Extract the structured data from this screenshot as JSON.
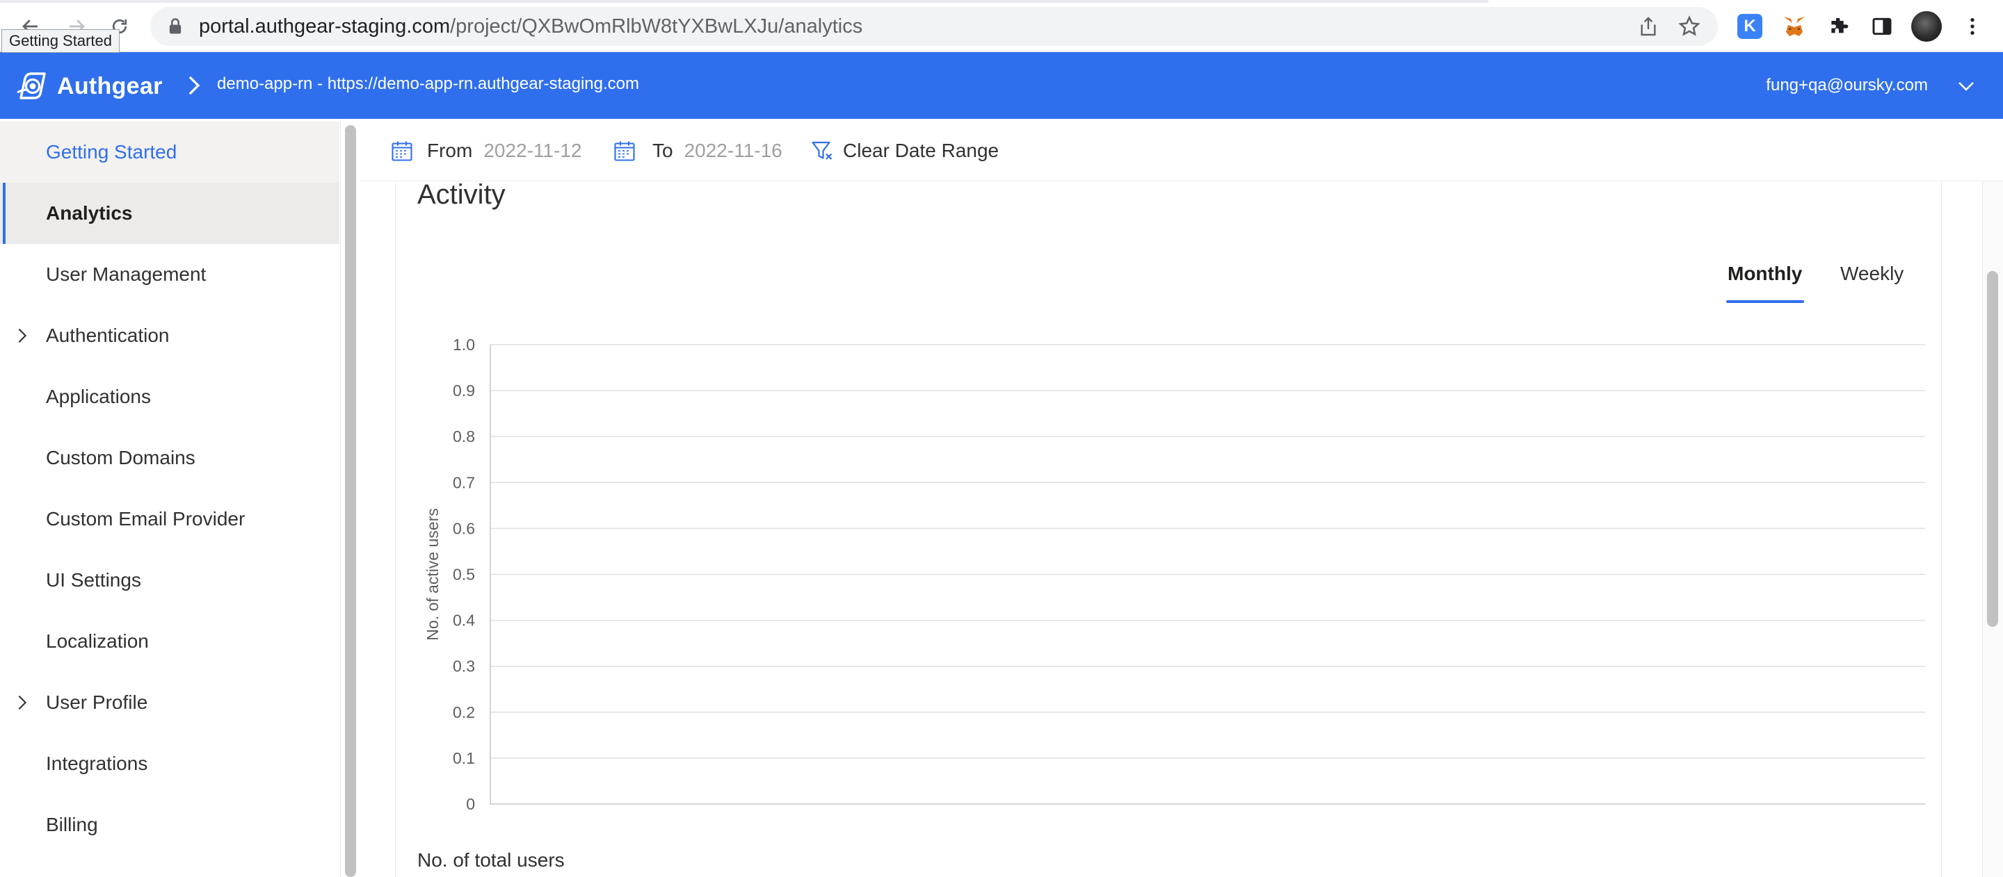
{
  "browser": {
    "tooltip": "Getting Started",
    "url_host": "portal.authgear-staging.com",
    "url_path": "/project/QXBwOmRlbW8tYXBwLXJu/analytics",
    "extensions": [
      "k-extension-icon",
      "metamask-fox-icon",
      "puzzle-extensions-icon",
      "side-panel-icon",
      "profile-avatar",
      "more-menu-icon"
    ],
    "k_label": "K"
  },
  "header": {
    "brand": "Authgear",
    "project": "demo-app-rn - https://demo-app-rn.authgear-staging.com",
    "account": "fung+qa@oursky.com",
    "color": "#2f6fed"
  },
  "sidebar": {
    "items": [
      {
        "label": "Getting Started",
        "state": "hover",
        "expandable": false
      },
      {
        "label": "Analytics",
        "state": "selected",
        "expandable": false
      },
      {
        "label": "User Management",
        "state": "normal",
        "expandable": false
      },
      {
        "label": "Authentication",
        "state": "normal",
        "expandable": true
      },
      {
        "label": "Applications",
        "state": "normal",
        "expandable": false
      },
      {
        "label": "Custom Domains",
        "state": "normal",
        "expandable": false
      },
      {
        "label": "Custom Email Provider",
        "state": "normal",
        "expandable": false
      },
      {
        "label": "UI Settings",
        "state": "normal",
        "expandable": false
      },
      {
        "label": "Localization",
        "state": "normal",
        "expandable": false
      },
      {
        "label": "User Profile",
        "state": "normal",
        "expandable": true
      },
      {
        "label": "Integrations",
        "state": "normal",
        "expandable": false
      },
      {
        "label": "Billing",
        "state": "normal",
        "expandable": false
      }
    ]
  },
  "toolbar": {
    "from_label": "From",
    "from_date": "2022-11-12",
    "to_label": "To",
    "to_date": "2022-11-16",
    "clear_label": "Clear Date Range"
  },
  "activity": {
    "title": "Activity",
    "tabs": [
      {
        "label": "Monthly",
        "selected": true
      },
      {
        "label": "Weekly",
        "selected": false
      }
    ],
    "total_users_label": "No. of total users"
  },
  "chart_data": {
    "type": "line",
    "title": "",
    "xlabel": "",
    "ylabel": "No. of active users",
    "ylim": [
      0,
      1
    ],
    "y_ticks": [
      "1.0",
      "0.9",
      "0.8",
      "0.7",
      "0.6",
      "0.5",
      "0.4",
      "0.3",
      "0.2",
      "0.1",
      "0"
    ],
    "series": [],
    "grid": true
  }
}
